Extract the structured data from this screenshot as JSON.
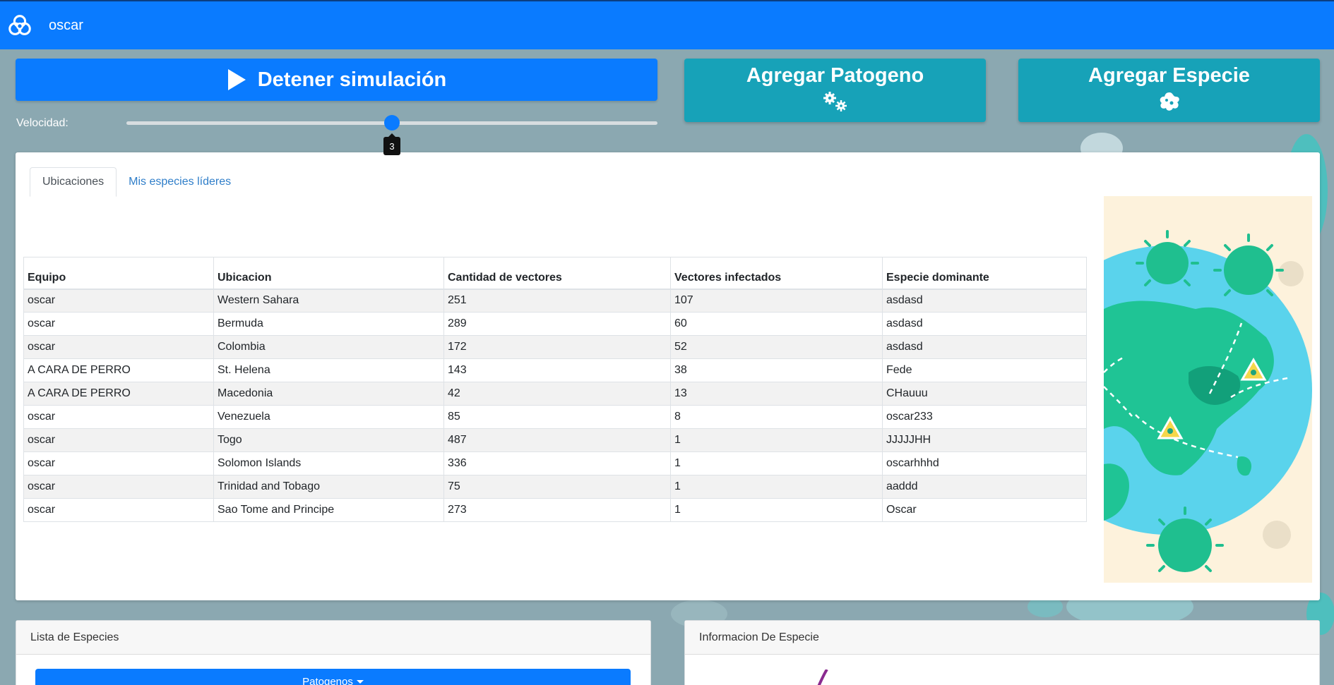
{
  "navbar": {
    "brand": "oscar",
    "logo_icon": "biohazard-icon"
  },
  "controls": {
    "sim_button_label": "Detener simulación",
    "add_pathogen_label": "Agregar Patogeno",
    "add_species_label": "Agregar Especie",
    "speed_label": "Velocidad:",
    "speed_value": "3",
    "speed_min": 1,
    "speed_max": 5
  },
  "tabs": [
    {
      "label": "Ubicaciones",
      "active": true
    },
    {
      "label": "Mis especies líderes",
      "active": false
    }
  ],
  "table": {
    "headers": [
      "Equipo",
      "Ubicacion",
      "Cantidad de vectores",
      "Vectores infectados",
      "Especie dominante"
    ],
    "rows": [
      [
        "oscar",
        "Western Sahara",
        "251",
        "107",
        "asdasd"
      ],
      [
        "oscar",
        "Bermuda",
        "289",
        "60",
        "asdasd"
      ],
      [
        "oscar",
        "Colombia",
        "172",
        "52",
        "asdasd"
      ],
      [
        "A CARA DE PERRO",
        "St. Helena",
        "143",
        "38",
        "Fede"
      ],
      [
        "A CARA DE PERRO",
        "Macedonia",
        "42",
        "13",
        "CHauuu"
      ],
      [
        "oscar",
        "Venezuela",
        "85",
        "8",
        "oscar233"
      ],
      [
        "oscar",
        "Togo",
        "487",
        "1",
        "JJJJJHH"
      ],
      [
        "oscar",
        "Solomon Islands",
        "336",
        "1",
        "oscarhhhd"
      ],
      [
        "oscar",
        "Trinidad and Tobago",
        "75",
        "1",
        "aaddd"
      ],
      [
        "oscar",
        "Sao Tome and Principe",
        "273",
        "1",
        "Oscar"
      ]
    ]
  },
  "species_list": {
    "title": "Lista de Especies",
    "dropdown_label": "Patogenos"
  },
  "species_info": {
    "title": "Informacion De Especie"
  },
  "colors": {
    "primary": "#0a7bff",
    "teal": "#17a2b8",
    "globe": "#5ad3ec",
    "virus": "#1fbf8f"
  }
}
